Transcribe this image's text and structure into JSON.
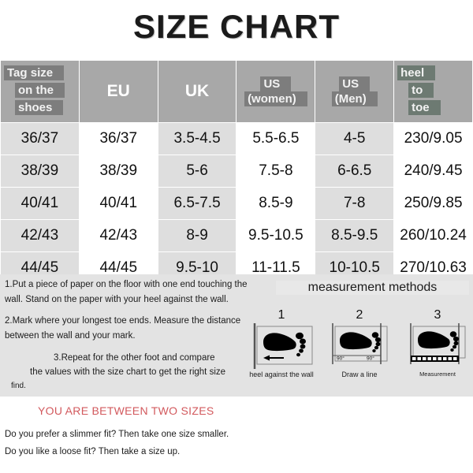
{
  "title": "SIZE CHART",
  "table": {
    "headers": [
      {
        "type": "stacked",
        "lines": [
          "Tag size",
          "on the",
          "shoes"
        ],
        "highlight": "gray"
      },
      {
        "type": "plain",
        "label": "EU"
      },
      {
        "type": "plain",
        "label": "UK"
      },
      {
        "type": "stacked",
        "lines": [
          "US",
          "(women)"
        ],
        "highlight": "gray"
      },
      {
        "type": "stacked",
        "lines": [
          "US",
          "(Men)"
        ],
        "highlight": "gray"
      },
      {
        "type": "stacked",
        "lines": [
          "heel",
          "to",
          "toe"
        ],
        "highlight": "green"
      }
    ],
    "rows": [
      [
        "36/37",
        "36/37",
        "3.5-4.5",
        "5.5-6.5",
        "4-5",
        "230/9.05"
      ],
      [
        "38/39",
        "38/39",
        "5-6",
        "7.5-8",
        "6-6.5",
        "240/9.45"
      ],
      [
        "40/41",
        "40/41",
        "6.5-7.5",
        "8.5-9",
        "7-8",
        "250/9.85"
      ],
      [
        "42/43",
        "42/43",
        "8-9",
        "9.5-10.5",
        "8.5-9.5",
        "260/10.24"
      ],
      [
        "44/45",
        "44/45",
        "9.5-10",
        "11-11.5",
        "10-10.5",
        "270/10.63"
      ]
    ]
  },
  "instructions": {
    "step1": "1.Put a piece of paper on the floor with one end touching the wall. Stand on the paper with your heel against the wall.",
    "step2": "2.Mark where your longest toe ends. Measure the distance between the wall and your mark.",
    "step3_line1": "3.Repeat for the other foot and compare",
    "step3_line2": "the values with the size chart to get the right size",
    "step3_line3": "find."
  },
  "measurement": {
    "title": "measurement methods",
    "diagrams": [
      {
        "number": "1",
        "caption": "heel against the wall",
        "angle_left": "",
        "angle_right": ""
      },
      {
        "number": "2",
        "caption": "Draw a line",
        "angle_left": "90°",
        "angle_right": "90°"
      },
      {
        "number": "3",
        "caption": "Measurement",
        "angle_left": "",
        "angle_right": ""
      }
    ]
  },
  "bottom": {
    "heading": "YOU ARE BETWEEN TWO SIZES",
    "line1": "Do you prefer a slimmer fit? Then take one size smaller.",
    "line2": "Do you like a loose fit? Then take a size up."
  },
  "colors": {
    "header_bg": "#a8a8a8",
    "highlight_gray": "#7d7d7d",
    "highlight_green": "#6d7a72",
    "row_shade": "#dedede",
    "band_bg": "#e3e3e3",
    "accent_red": "#d2595d"
  }
}
